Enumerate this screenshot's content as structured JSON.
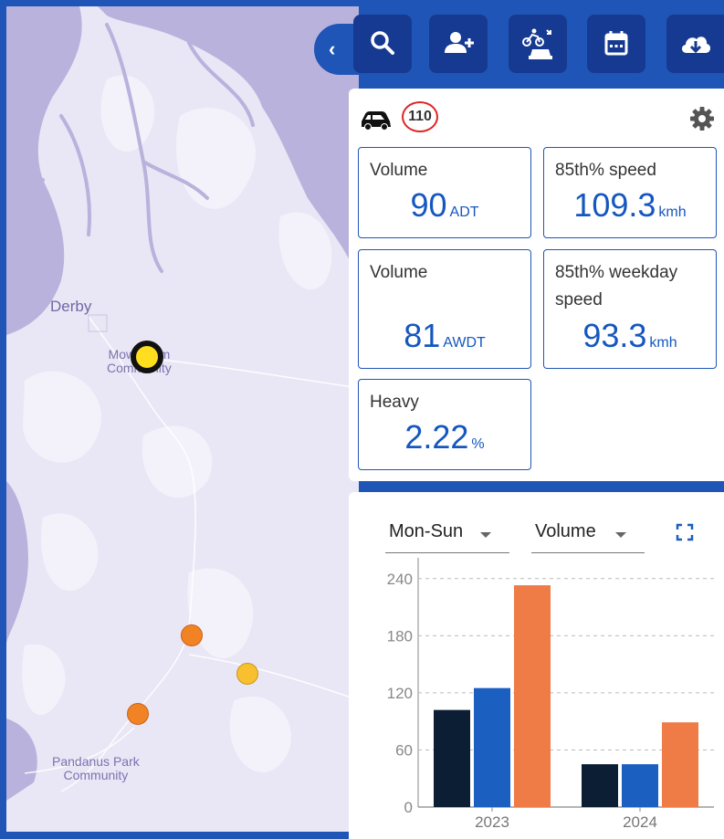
{
  "map": {
    "places": {
      "derby": "Derby",
      "community_1": "Mowanjum\nCommunity",
      "community_2": "Pandanus Park\nCommunity"
    },
    "markers": [
      {
        "name": "selected-site-marker",
        "kind": "selected",
        "color": "#FFDD1F"
      },
      {
        "name": "site-marker-orange-1",
        "kind": "orange",
        "color": "#F28324"
      },
      {
        "name": "site-marker-amber",
        "kind": "amber",
        "color": "#F8C02E"
      },
      {
        "name": "site-marker-orange-2",
        "kind": "orange",
        "color": "#F28324"
      }
    ]
  },
  "toolbar": {
    "buttons": [
      {
        "name": "search-button",
        "icon": "search-icon"
      },
      {
        "name": "add-user-button",
        "icon": "add-user-icon"
      },
      {
        "name": "transport-modes-button",
        "icon": "cyclist-car-icon"
      },
      {
        "name": "calendar-button",
        "icon": "calendar-icon"
      },
      {
        "name": "download-button",
        "icon": "cloud-download-icon"
      }
    ],
    "collapse_icon": "chevron-left-icon"
  },
  "summary": {
    "site_icon": "car-icon",
    "site_id": "110",
    "settings_icon": "gear-icon",
    "stats": {
      "volume_adt": {
        "label": "Volume",
        "value": "90",
        "unit": "ADT"
      },
      "speed_85": {
        "label": "85th% speed",
        "value": "109.3",
        "unit": "kmh"
      },
      "volume_awdt": {
        "label": "Volume",
        "value": "81",
        "unit": "AWDT"
      },
      "speed_85_weekday": {
        "label": "85th% weekday speed",
        "value": "93.3",
        "unit": "kmh"
      },
      "heavy": {
        "label": "Heavy",
        "value": "2.22",
        "unit": "%"
      }
    }
  },
  "chart_controls": {
    "period_select": "Mon-Sun",
    "metric_select": "Volume",
    "expand_icon": "fullscreen-icon"
  },
  "chart_data": {
    "type": "bar",
    "categories": [
      "2023",
      "2024"
    ],
    "series": [
      {
        "color": "#0B1E33",
        "values": [
          102,
          45
        ]
      },
      {
        "color": "#1B5FC1",
        "values": [
          125,
          45
        ]
      },
      {
        "color": "#EF7B47",
        "values": [
          233,
          89
        ]
      }
    ],
    "yticks": [
      0,
      60,
      120,
      180,
      240
    ],
    "ylim": [
      0,
      258
    ],
    "grid": true
  }
}
